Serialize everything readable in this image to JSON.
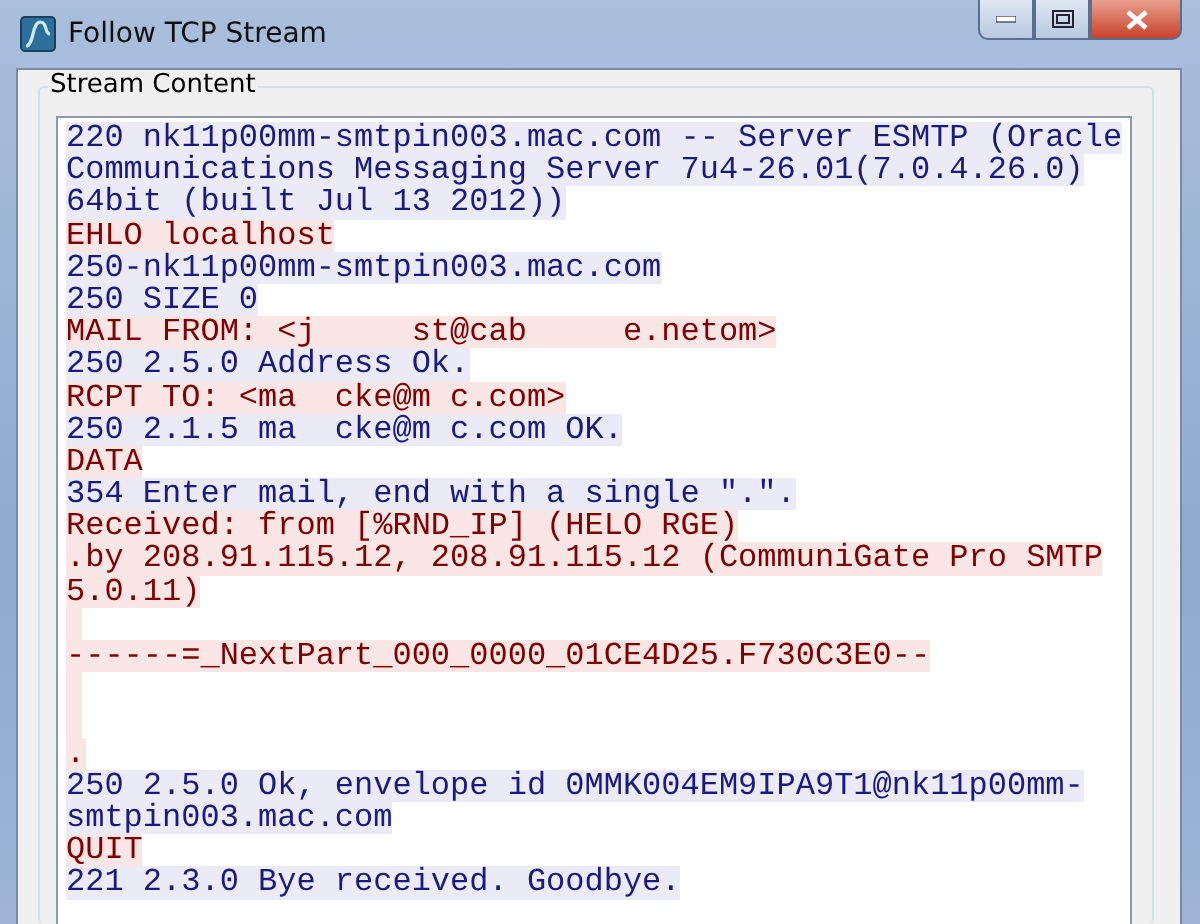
{
  "window": {
    "title": "Follow TCP Stream",
    "controls": [
      {
        "kind": "minimize"
      },
      {
        "kind": "maximize"
      },
      {
        "kind": "close"
      }
    ]
  },
  "stream": {
    "title": "Stream Content",
    "lines": [
      {
        "kind": "server",
        "text": "220 nk11p00mm-smtpin003.mac.com -- Server ESMTP (Oracle"
      },
      {
        "kind": "server",
        "text": "Communications Messaging Server 7u4-26.01(7.0.4.26.0)"
      },
      {
        "kind": "server",
        "text": "64bit (built Jul 13 2012))"
      },
      {
        "kind": "client",
        "text": "EHLO localhost"
      },
      {
        "kind": "server",
        "text": "250-nk11p00mm-smtpin003.mac.com"
      },
      {
        "kind": "server",
        "text": "250 SIZE 0"
      },
      {
        "kind": "client",
        "text": "MAIL FROM: <j     st@cab     e.netom>"
      },
      {
        "kind": "server",
        "text": "250 2.5.0 Address Ok."
      },
      {
        "kind": "client",
        "text": "RCPT TO: <ma  cke@m c.com>"
      },
      {
        "kind": "server",
        "text": "250 2.1.5 ma  cke@m c.com OK."
      },
      {
        "kind": "client",
        "text": "DATA"
      },
      {
        "kind": "server",
        "text": "354 Enter mail, end with a single \".\"."
      },
      {
        "kind": "client",
        "text": "Received: from [%RND_IP] (HELO RGE)"
      },
      {
        "kind": "client",
        "text": ".by 208.91.115.12, 208.91.115.12 (CommuniGate Pro SMTP"
      },
      {
        "kind": "client",
        "text": "5.0.11)"
      },
      {
        "kind": "gap"
      },
      {
        "kind": "client",
        "text": "------=_NextPart_000_0000_01CE4D25.F730C3E0--"
      },
      {
        "kind": "gap"
      },
      {
        "kind": "gap"
      },
      {
        "kind": "client",
        "text": "."
      },
      {
        "kind": "server",
        "text": "250 2.5.0 Ok, envelope id 0MMK004EM9IPA9T1@nk11p00mm-"
      },
      {
        "kind": "server",
        "text": "smtpin003.mac.com"
      },
      {
        "kind": "client",
        "text": "QUIT"
      },
      {
        "kind": "server",
        "text": "221 2.3.0 Bye received. Goodbye."
      }
    ]
  }
}
